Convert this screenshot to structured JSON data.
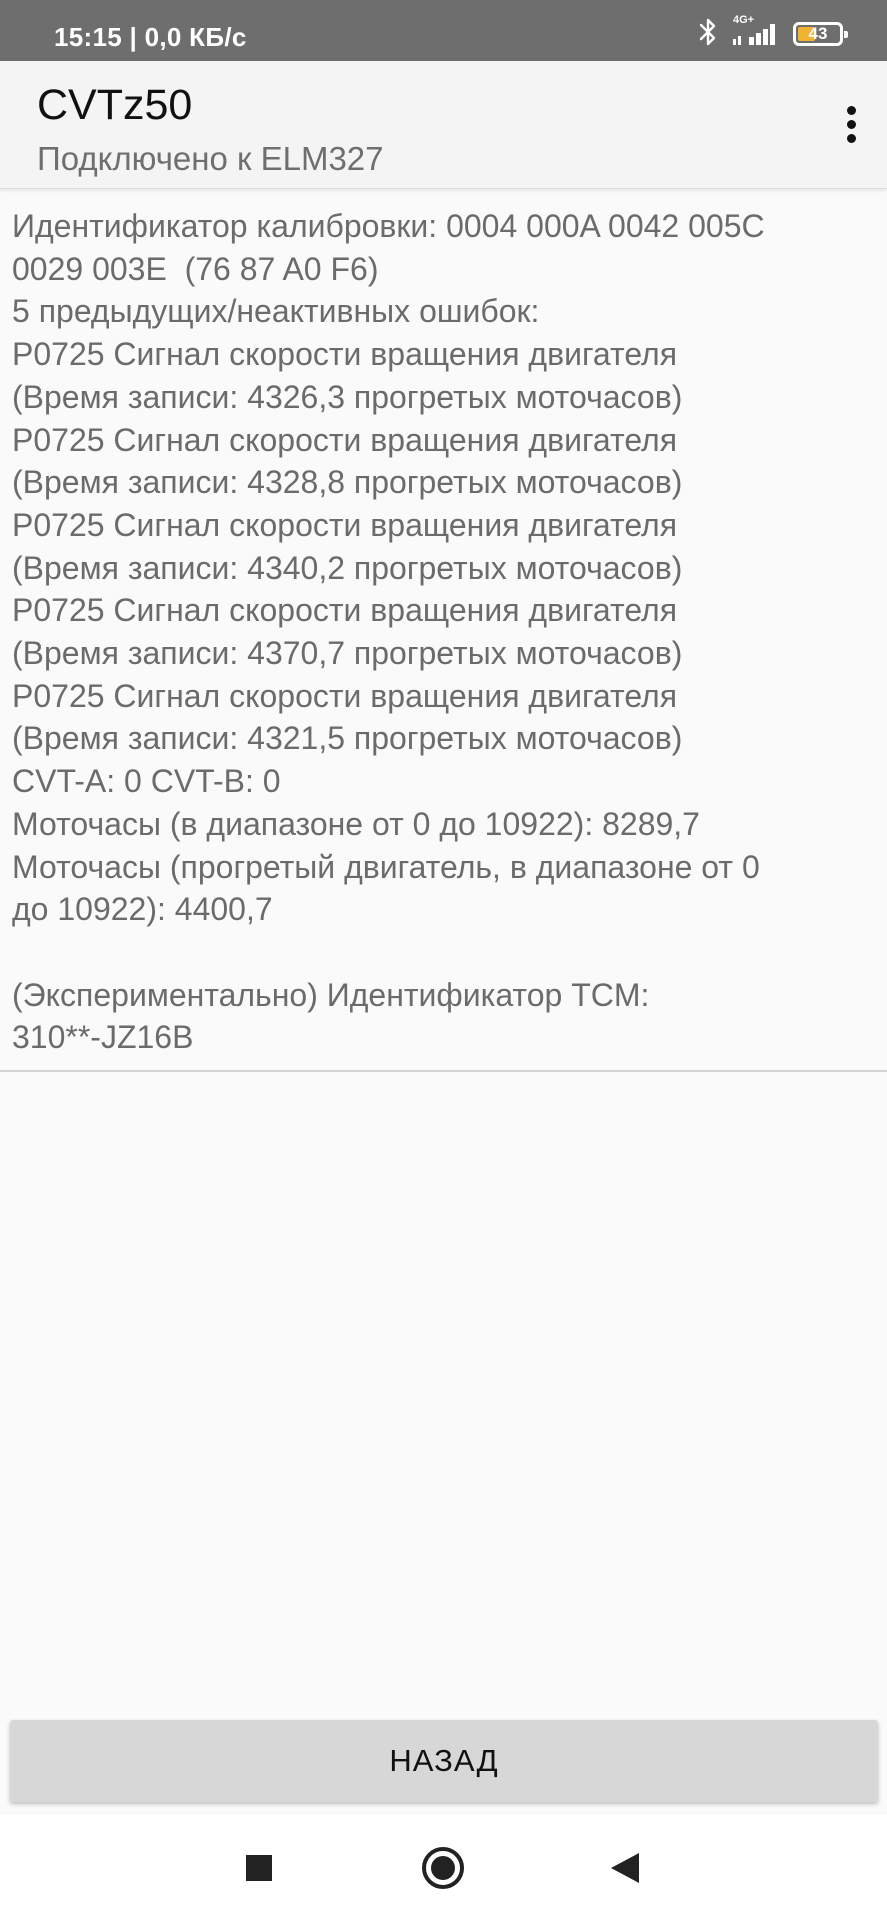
{
  "status_bar": {
    "time_speed": "15:15 | 0,0 КБ/с",
    "network": "4G+",
    "battery_level": "43",
    "battery_fraction": 0.43,
    "icons": [
      "bluetooth-icon",
      "signal-icon",
      "battery-icon"
    ]
  },
  "app_bar": {
    "title": "CVTz50",
    "subtitle": "Подключено к ELM327",
    "menu_icon": "overflow-menu-icon"
  },
  "content": {
    "text": "Идентификатор калибровки: 0004 000A 0042 005C\n0029 003E  (76 87 A0 F6)\n5 предыдущих/неактивных ошибок:\nP0725 Сигнал скорости вращения двигателя\n(Время записи: 4326,3 прогретых моточасов)\nP0725 Сигнал скорости вращения двигателя\n(Время записи: 4328,8 прогретых моточасов)\nP0725 Сигнал скорости вращения двигателя\n(Время записи: 4340,2 прогретых моточасов)\nP0725 Сигнал скорости вращения двигателя\n(Время записи: 4370,7 прогретых моточасов)\nP0725 Сигнал скорости вращения двигателя\n(Время записи: 4321,5 прогретых моточасов)\nCVT-A: 0 CVT-B: 0\nМоточасы (в диапазоне от 0 до 10922): 8289,7\nМоточасы (прогретый двигатель, в диапазоне от 0\nдо 10922): 4400,7\n\n(Экспериментально) Идентификатор TCM:\n310**-JZ16B"
  },
  "back_button": {
    "label": "НАЗАД"
  },
  "nav_bar": {
    "items": [
      "recents-square-icon",
      "home-circle-icon",
      "back-triangle-icon"
    ]
  },
  "colors": {
    "status_bar_bg": "#6e6e6e",
    "battery_accent": "#f2b233",
    "app_bar_bg": "#f4f4f4",
    "body_text": "#6b6b6b",
    "button_bg": "#d7d7d7"
  }
}
